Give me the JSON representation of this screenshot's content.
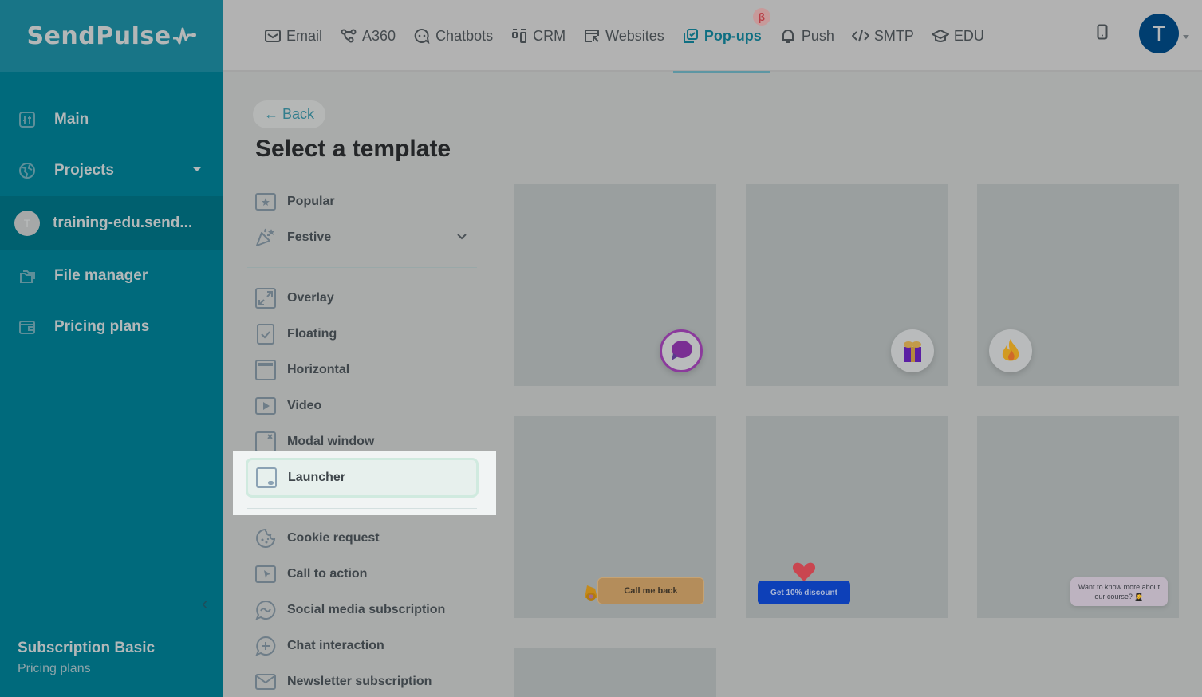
{
  "brand": {
    "name": "SendPulse"
  },
  "topnav": {
    "items": [
      {
        "label": "Email",
        "icon": "mail-icon",
        "active": false
      },
      {
        "label": "A360",
        "icon": "flow-icon",
        "active": false
      },
      {
        "label": "Chatbots",
        "icon": "chatbot-icon",
        "active": false
      },
      {
        "label": "CRM",
        "icon": "crm-icon",
        "active": false
      },
      {
        "label": "Websites",
        "icon": "website-icon",
        "active": false
      },
      {
        "label": "Pop-ups",
        "icon": "popups-icon",
        "active": true,
        "badge": "β"
      },
      {
        "label": "Push",
        "icon": "bell-icon",
        "active": false
      },
      {
        "label": "SMTP",
        "icon": "code-icon",
        "active": false
      },
      {
        "label": "EDU",
        "icon": "graduation-cap-icon",
        "active": false
      }
    ],
    "user_initial": "T"
  },
  "sidebar": {
    "items": [
      {
        "label": "Main",
        "icon": "dashboard-icon"
      },
      {
        "label": "Projects",
        "icon": "globe-icon"
      },
      {
        "label": "training-edu.send...",
        "avatar": "T",
        "active": true
      },
      {
        "label": "File manager",
        "icon": "folder-icon"
      },
      {
        "label": "Pricing plans",
        "icon": "wallet-icon"
      }
    ],
    "subscription": {
      "title": "Subscription Basic",
      "link": "Pricing plans"
    }
  },
  "main": {
    "back_label": "← Back",
    "title": "Select a template",
    "categories_top": [
      {
        "label": "Popular",
        "icon": "star-icon"
      },
      {
        "label": "Festive",
        "icon": "party-popper-icon",
        "expandable": true
      }
    ],
    "categories_types": [
      {
        "label": "Overlay",
        "icon": "expand-icon"
      },
      {
        "label": "Floating",
        "icon": "check-box-icon"
      },
      {
        "label": "Horizontal",
        "icon": "horizontal-bar-icon"
      },
      {
        "label": "Video",
        "icon": "play-icon"
      },
      {
        "label": "Modal window",
        "icon": "modal-close-icon"
      }
    ],
    "selected_category": {
      "label": "Launcher",
      "icon": "launcher-icon"
    },
    "categories_goals": [
      {
        "label": "Cookie request",
        "icon": "cookie-icon"
      },
      {
        "label": "Call to action",
        "icon": "cursor-icon"
      },
      {
        "label": "Social media subscription",
        "icon": "messenger-icon"
      },
      {
        "label": "Chat interaction",
        "icon": "chat-plus-icon"
      },
      {
        "label": "Newsletter subscription",
        "icon": "envelope-icon"
      }
    ],
    "templates": [
      {
        "type": "bubble",
        "icon": "chat-bubble-icon"
      },
      {
        "type": "bubble",
        "icon": "gift-icon"
      },
      {
        "type": "bubble",
        "icon": "fire-icon"
      },
      {
        "type": "button",
        "label": "Call me back",
        "icon": "bell-icon"
      },
      {
        "type": "button",
        "label": "Get 10% discount",
        "icon": "heart-icon"
      },
      {
        "type": "message",
        "label": "Want to know more about our course? 👩‍🎓"
      },
      {
        "type": "blank"
      }
    ]
  }
}
